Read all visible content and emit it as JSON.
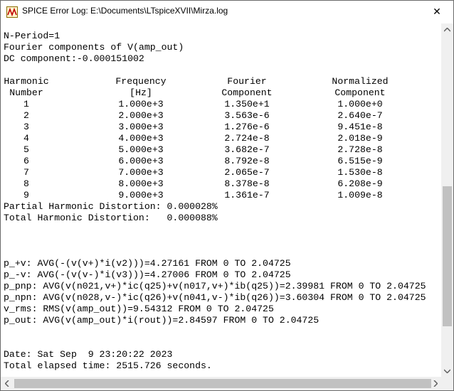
{
  "window": {
    "title": "SPICE Error Log: E:\\Documents\\LTspiceXVII\\Mirza.log",
    "close_symbol": "✕"
  },
  "log": {
    "header_lines": [
      "N-Period=1",
      "Fourier components of V(amp_out)",
      "DC component:-0.000151002"
    ],
    "table": {
      "headers_row1": [
        "Harmonic",
        "Frequency",
        "Fourier",
        "Normalized"
      ],
      "headers_row2": [
        "Number",
        "[Hz]",
        "Component",
        "Component"
      ],
      "rows": [
        [
          "1",
          "1.000e+3",
          "1.350e+1",
          "1.000e+0"
        ],
        [
          "2",
          "2.000e+3",
          "3.563e-6",
          "2.640e-7"
        ],
        [
          "3",
          "3.000e+3",
          "1.276e-6",
          "9.451e-8"
        ],
        [
          "4",
          "4.000e+3",
          "2.724e-8",
          "2.018e-9"
        ],
        [
          "5",
          "5.000e+3",
          "3.682e-7",
          "2.728e-8"
        ],
        [
          "6",
          "6.000e+3",
          "8.792e-8",
          "6.515e-9"
        ],
        [
          "7",
          "7.000e+3",
          "2.065e-7",
          "1.530e-8"
        ],
        [
          "8",
          "8.000e+3",
          "8.378e-8",
          "6.208e-9"
        ],
        [
          "9",
          "9.000e+3",
          "1.361e-7",
          "1.009e-8"
        ]
      ]
    },
    "distortion_lines": [
      "Partial Harmonic Distortion: 0.000028%",
      "Total Harmonic Distortion:   0.000088%"
    ],
    "measurement_lines": [
      "p_+v: AVG(-(v(v+)*i(v2)))=4.27161 FROM 0 TO 2.04725",
      "p_-v: AVG(-(v(v-)*i(v3)))=4.27006 FROM 0 TO 2.04725",
      "p_pnp: AVG(v(n021,v+)*ic(q25)+v(n017,v+)*ib(q25))=2.39981 FROM 0 TO 2.04725",
      "p_npn: AVG(v(n028,v-)*ic(q26)+v(n041,v-)*ib(q26))=3.60304 FROM 0 TO 2.04725",
      "v_rms: RMS(v(amp_out))=9.54312 FROM 0 TO 2.04725",
      "p_out: AVG(v(amp_out)*i(rout))=2.84597 FROM 0 TO 2.04725"
    ],
    "footer_lines": [
      "Date: Sat Sep  9 23:20:22 2023",
      "Total elapsed time: 2515.726 seconds."
    ]
  },
  "icons": {
    "app": "ltspice-app-icon",
    "close": "close-icon",
    "scroll_up": "scroll-up-arrow-icon",
    "scroll_down": "scroll-down-arrow-icon",
    "scroll_left": "scroll-left-arrow-icon",
    "scroll_right": "scroll-right-arrow-icon"
  }
}
